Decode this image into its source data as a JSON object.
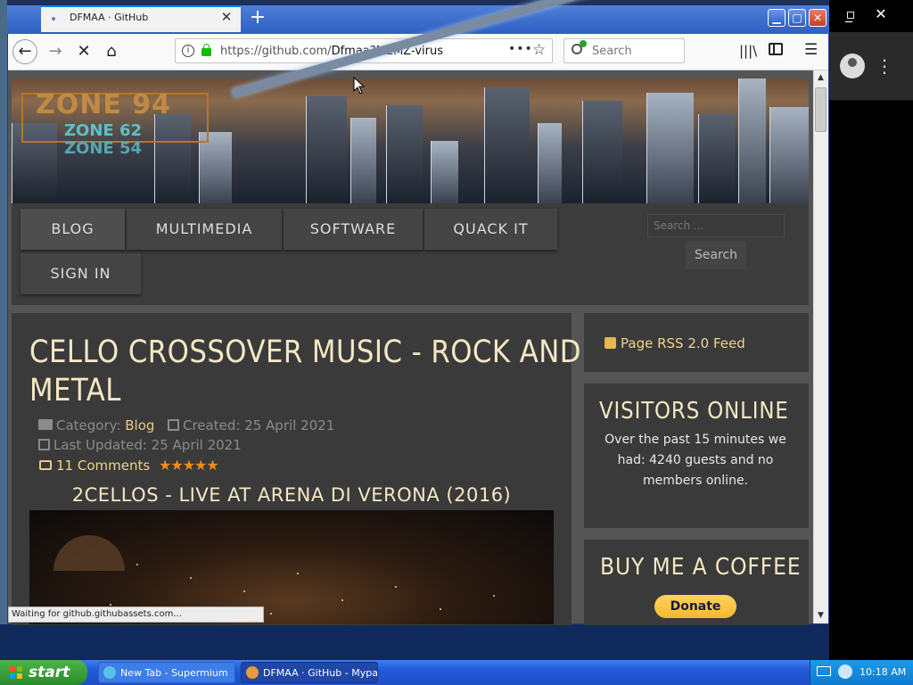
{
  "browser": {
    "tab_title": "DFMAA · GitHub",
    "url_host": "https://github.com/",
    "url_path": "Dfmaa?MEMZ-virus",
    "search_placeholder": "Search",
    "url_more": "•••",
    "status_text": "Waiting for github.githubassets.com..."
  },
  "site": {
    "logo": [
      "ZONE 94",
      "ZONE 62",
      "ZONE 54"
    ],
    "nav": [
      "BLOG",
      "MULTIMEDIA",
      "SOFTWARE",
      "QUACK IT",
      "SIGN IN"
    ],
    "search_placeholder": "Search ...",
    "search_button": "Search"
  },
  "article": {
    "title_line1": "CELLO CROSSOVER MUSIC - ROCK AND",
    "title_line2": "METAL",
    "category_label": "Category:",
    "category_value": "Blog",
    "created": "Created: 25 April 2021",
    "updated": "Last Updated: 25 April 2021",
    "comments": "11 Comments",
    "rating_stars": "★★★★★",
    "rating_value": 5,
    "video_title": "2CELLOS - LIVE AT ARENA DI VERONA (2016)"
  },
  "sidebar": {
    "rss": "Page RSS 2.0 Feed",
    "visitors_title": "VISITORS ONLINE",
    "visitors_text": "Over the past 15 minutes we had: 4240 guests and no members online.",
    "coffee_title": "BUY ME A COFFEE",
    "donate": "Donate"
  },
  "taskbar": {
    "start": "start",
    "tasks": [
      "New Tab - Supermium",
      "DFMAA · GitHub - Mypal"
    ],
    "clock": "10:18 AM"
  },
  "colors": {
    "accent_gold": "#f4e7c4",
    "link_gold": "#f0d48a",
    "star_orange": "#f28c1a",
    "xp_blue": "#2358d8"
  }
}
